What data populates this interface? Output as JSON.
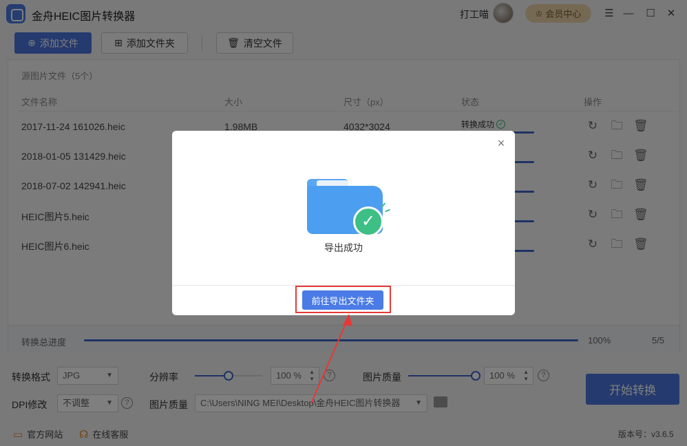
{
  "app": {
    "title": "金舟HEIC图片转换器",
    "user_name": "打工喵",
    "vip_label": "会员中心",
    "window_controls": [
      "menu-icon",
      "minimize-icon",
      "maximize-icon",
      "close-icon"
    ]
  },
  "toolbar": {
    "add_file": "添加文件",
    "add_folder": "添加文件夹",
    "clear_files": "清空文件"
  },
  "file_panel": {
    "title": "源图片文件（5个）",
    "columns": {
      "name": "文件名称",
      "size": "大小",
      "dimensions": "尺寸（px）",
      "status": "状态",
      "actions": "操作"
    },
    "rows": [
      {
        "name": "2017-11-24 161026.heic",
        "size": "1.98MB",
        "dimensions": "4032*3024",
        "status": "转换成功",
        "progress": 1.0
      },
      {
        "name": "2018-01-05 131429.heic",
        "size": "",
        "dimensions": "",
        "status": "",
        "progress": 1.0
      },
      {
        "name": "2018-07-02 142941.heic",
        "size": "",
        "dimensions": "",
        "status": "",
        "progress": 1.0
      },
      {
        "name": "HEIC图片5.heic",
        "size": "",
        "dimensions": "",
        "status": "",
        "progress": 1.0
      },
      {
        "name": "HEIC图片6.heic",
        "size": "",
        "dimensions": "",
        "status": "",
        "progress": 1.0
      }
    ],
    "action_icons": [
      "refresh-icon",
      "folder-icon",
      "trash-icon"
    ]
  },
  "progress": {
    "label": "转换总进度",
    "percent_text": "100%",
    "value": 1.0,
    "count_text": "5/5"
  },
  "settings": {
    "format_label": "转换格式",
    "format_value": "JPG",
    "resolution_label": "分辨率",
    "resolution_value": "100",
    "resolution_unit": "%",
    "resolution_level": 0.5,
    "quality_label": "图片质量",
    "quality_value": "100",
    "quality_unit": "%",
    "quality_level": 1.0,
    "dpi_label": "DPI修改",
    "dpi_value": "不调整",
    "output_label": "图片质量",
    "output_path": "C:\\Users\\NING MEI\\Desktop\\金舟HEIC图片转换器",
    "help_glyph": "?"
  },
  "start_button": "开始转换",
  "footer": {
    "website": "官方网站",
    "support": "在线客服",
    "version": "版本号：v3.6.5"
  },
  "modal": {
    "message": "导出成功",
    "button": "前往导出文件夹",
    "close_glyph": "×"
  },
  "colors": {
    "primary": "#4a74dc",
    "success": "#3dbf86",
    "annotation": "#e53935",
    "vip": "#ecd3a9"
  }
}
